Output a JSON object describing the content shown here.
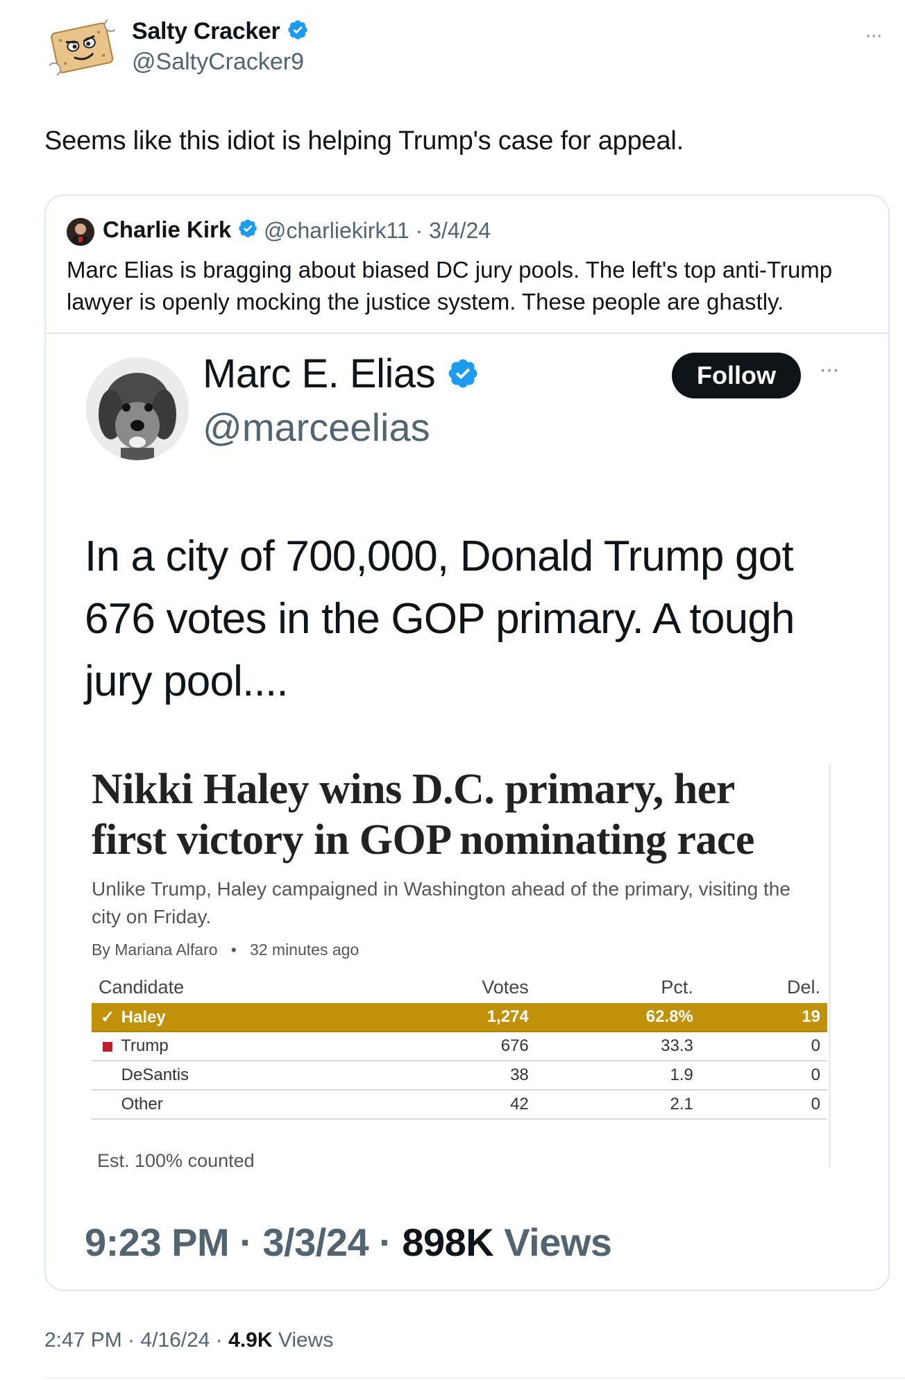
{
  "top_tweet": {
    "author_name": "Salty Cracker",
    "author_handle": "@SaltyCracker9",
    "more_label": "···",
    "text": "Seems like this idiot is helping Trump's case for appeal.",
    "timestamp": "2:47 PM · 4/16/24 · ",
    "views_count": "4.9K",
    "views_label": " Views"
  },
  "quote": {
    "author_name": "Charlie Kirk",
    "author_handle": "@charliekirk11",
    "date": "3/4/24",
    "text": "Marc Elias is bragging about biased DC jury pools. The left's top anti-Trump lawyer is openly mocking the justice system. These people are ghastly."
  },
  "embedded_tweet": {
    "author_name": "Marc E. Elias",
    "author_handle": "@marceelias",
    "follow_label": "Follow",
    "more_label": "···",
    "text": "In a city of 700,000, Donald Trump got 676 votes in the GOP primary. A tough jury pool....",
    "time": "9:23 PM · 3/3/24 · ",
    "views_count": "898K",
    "views_label": " Views"
  },
  "article": {
    "headline": "Nikki Haley wins D.C. primary, her first victory in GOP nominating race",
    "dek": "Unlike Trump, Haley campaigned in Washington ahead of the primary, visiting the city on Friday.",
    "byline_author": "By Mariana Alfaro",
    "byline_time": "32 minutes ago",
    "results": {
      "headers": [
        "Candidate",
        "Votes",
        "Pct.",
        "Del."
      ],
      "rows": [
        {
          "candidate": "Haley",
          "votes": "1,274",
          "pct": "62.8%",
          "del": "19"
        },
        {
          "candidate": "Trump",
          "votes": "676",
          "pct": "33.3",
          "del": "0"
        },
        {
          "candidate": "DeSantis",
          "votes": "38",
          "pct": "1.9",
          "del": "0"
        },
        {
          "candidate": "Other",
          "votes": "42",
          "pct": "2.1",
          "del": "0"
        }
      ],
      "winner_color": "#c1910a",
      "trump_color": "#c0202c",
      "footnote": "Est. 100% counted"
    }
  },
  "colors": {
    "verified_blue": "#1d9bf0",
    "muted_text": "#536471"
  }
}
